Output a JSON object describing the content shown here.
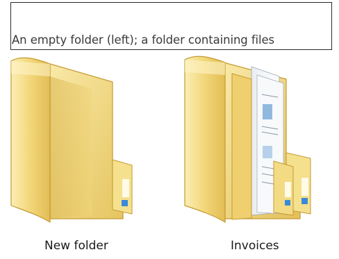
{
  "caption": {
    "text": "An empty folder (left); a folder containing files"
  },
  "folders": [
    {
      "label": "New folder",
      "icon": "empty-folder-icon"
    },
    {
      "label": "Invoices",
      "icon": "folder-with-files-icon"
    }
  ],
  "colors": {
    "folder_light": "#f7e39a",
    "folder_mid": "#eecf6d",
    "folder_dark": "#d9b24a",
    "folder_edge": "#c49a30",
    "accent_blue": "#3b8ad9"
  }
}
